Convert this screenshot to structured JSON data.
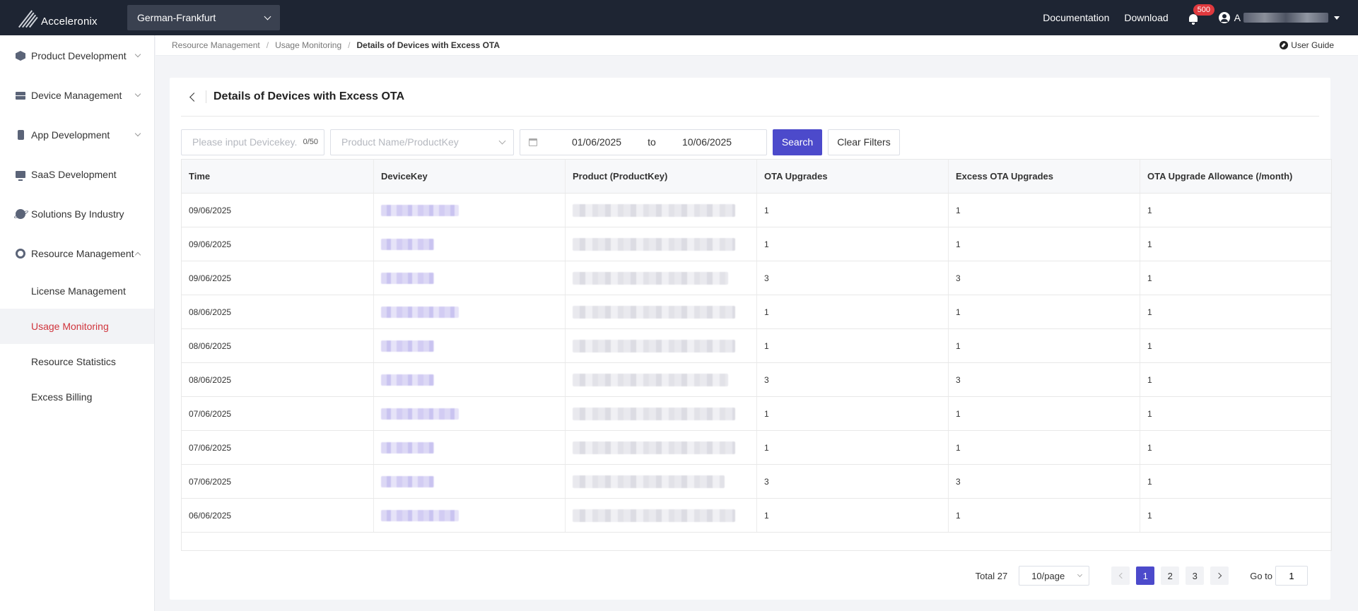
{
  "header": {
    "logo_text": "Acceleronix",
    "region": "German-Frankfurt",
    "nav": [
      "Documentation",
      "Download"
    ],
    "notification_count": "500",
    "user_initial": "A"
  },
  "sidebar": {
    "groups": [
      {
        "label": "Product Development",
        "icon": "cube-icon"
      },
      {
        "label": "Device Management",
        "icon": "server-icon"
      },
      {
        "label": "App Development",
        "icon": "phone-icon"
      },
      {
        "label": "SaaS Development",
        "icon": "monitor-icon"
      },
      {
        "label": "Solutions By Industry",
        "icon": "planet-icon"
      },
      {
        "label": "Resource Management",
        "icon": "gear-icon"
      }
    ],
    "sub_items": [
      "License Management",
      "Usage Monitoring",
      "Resource Statistics",
      "Excess Billing"
    ],
    "active_sub": "Usage Monitoring"
  },
  "breadcrumb": [
    "Resource Management",
    "Usage Monitoring",
    "Details of Devices with Excess OTA"
  ],
  "user_guide": "User Guide",
  "page_title": "Details of Devices with Excess OTA",
  "filters": {
    "devicekey_placeholder": "Please input Devicekey.",
    "devicekey_count": "0/50",
    "product_placeholder": "Product Name/ProductKey",
    "date_from": "01/06/2025",
    "date_to_label": "to",
    "date_to": "10/06/2025",
    "search_label": "Search",
    "clear_label": "Clear Filters"
  },
  "table": {
    "columns": [
      "Time",
      "DeviceKey",
      "Product (ProductKey)",
      "OTA Upgrades",
      "Excess OTA Upgrades",
      "OTA Upgrade Allowance (/month)"
    ],
    "rows": [
      {
        "time": "09/06/2025",
        "ota": "1",
        "excess": "1",
        "allowance": "1"
      },
      {
        "time": "09/06/2025",
        "ota": "1",
        "excess": "1",
        "allowance": "1"
      },
      {
        "time": "09/06/2025",
        "ota": "3",
        "excess": "3",
        "allowance": "1"
      },
      {
        "time": "08/06/2025",
        "ota": "1",
        "excess": "1",
        "allowance": "1"
      },
      {
        "time": "08/06/2025",
        "ota": "1",
        "excess": "1",
        "allowance": "1"
      },
      {
        "time": "08/06/2025",
        "ota": "3",
        "excess": "3",
        "allowance": "1"
      },
      {
        "time": "07/06/2025",
        "ota": "1",
        "excess": "1",
        "allowance": "1"
      },
      {
        "time": "07/06/2025",
        "ota": "1",
        "excess": "1",
        "allowance": "1"
      },
      {
        "time": "07/06/2025",
        "ota": "3",
        "excess": "3",
        "allowance": "1"
      },
      {
        "time": "06/06/2025",
        "ota": "1",
        "excess": "1",
        "allowance": "1"
      }
    ]
  },
  "pagination": {
    "total": "Total 27",
    "page_size": "10/page",
    "pages": [
      "1",
      "2",
      "3"
    ],
    "current_page": "1",
    "goto_label": "Go to",
    "goto_value": "1"
  },
  "colors": {
    "primary": "#4c4acb",
    "active_text": "#d0343c",
    "topbar": "#1e2533",
    "badge": "#e0393e"
  }
}
